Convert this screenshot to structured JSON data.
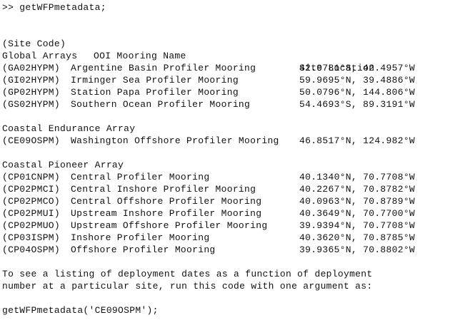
{
  "console": {
    "command": ">> getWFPmetadata;",
    "header": {
      "code": "(Site Code)",
      "name": "OOI Mooring Name",
      "location": "Site Location"
    },
    "groups": [
      {
        "title": "Global Arrays",
        "rows": [
          {
            "code": "(GA02HYPM)",
            "name": "Argentine Basin Profiler Mooring",
            "location": "42.9781°S, 42.4957°W"
          },
          {
            "code": "(GI02HYPM)",
            "name": "Irminger Sea Profiler Mooring",
            "location": "59.9695°N, 39.4886°W"
          },
          {
            "code": "(GP02HYPM)",
            "name": "Station Papa Profiler Mooring",
            "location": "50.0796°N, 144.806°W"
          },
          {
            "code": "(GS02HYPM)",
            "name": "Southern Ocean Profiler Mooring",
            "location": "54.4693°S, 89.3191°W"
          }
        ]
      },
      {
        "title": "Coastal Endurance Array",
        "rows": [
          {
            "code": "(CE09OSPM)",
            "name": "Washington Offshore Profiler Mooring",
            "location": "46.8517°N, 124.982°W"
          }
        ]
      },
      {
        "title": "Coastal Pioneer Array",
        "rows": [
          {
            "code": "(CP01CNPM)",
            "name": "Central Profiler Mooring",
            "location": "40.1340°N, 70.7708°W"
          },
          {
            "code": "(CP02PMCI)",
            "name": "Central Inshore Profiler Mooring",
            "location": "40.2267°N, 70.8782°W"
          },
          {
            "code": "(CP02PMCO)",
            "name": "Central Offshore Profiler Mooring",
            "location": "40.0963°N, 70.8789°W"
          },
          {
            "code": "(CP02PMUI)",
            "name": "Upstream Inshore Profiler Mooring",
            "location": "40.3649°N, 70.7700°W"
          },
          {
            "code": "(CP02PMUO)",
            "name": "Upstream Offshore Profiler Mooring",
            "location": "39.9394°N, 70.7708°W"
          },
          {
            "code": "(CP03ISPM)",
            "name": "Inshore Profiler Mooring",
            "location": "40.3620°N, 70.8785°W"
          },
          {
            "code": "(CP04OSPM)",
            "name": "Offshore Profiler Mooring",
            "location": "39.9365°N, 70.8802°W"
          }
        ]
      }
    ],
    "footer_line1": "To see a listing of deployment dates as a function of deployment",
    "footer_line2": "number at a particular site, run this code with one argument as:",
    "example_command": "getWFPmetadata('CE09OSPM');"
  }
}
